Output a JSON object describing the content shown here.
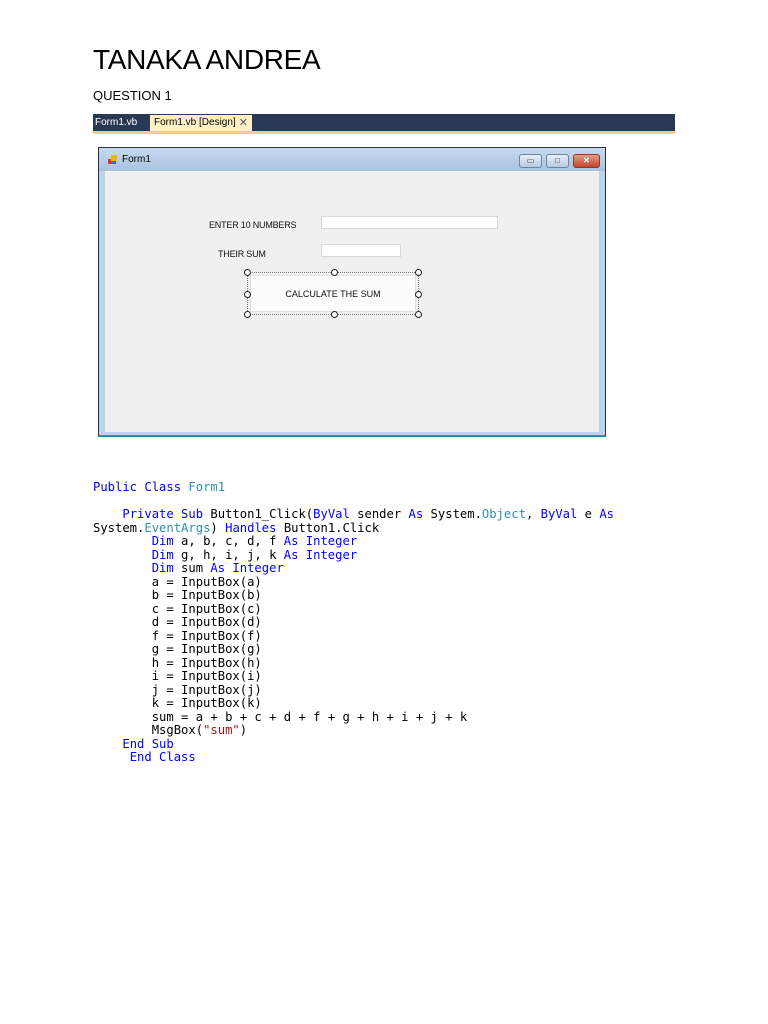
{
  "document": {
    "author": "TANAKA ANDREA",
    "question": "QUESTION 1"
  },
  "ide": {
    "tabs": [
      {
        "label": "Form1.vb",
        "active": false
      },
      {
        "label": "Form1.vb [Design]",
        "active": true
      }
    ],
    "tab_close": "✕"
  },
  "form": {
    "title": "Form1",
    "controls": {
      "label1": "ENTER 10 NUMBERS",
      "label2": "THEIR SUM",
      "button": "CALCULATE THE SUM",
      "textbox1_value": "",
      "textbox2_value": ""
    },
    "window_buttons": {
      "minimize": "▭",
      "maximize": "□",
      "close": "✕"
    }
  },
  "colors": {
    "keyword": "#0000ff",
    "type": "#2b91af",
    "string": "#a31515"
  },
  "code": [
    [
      [
        "Public Class ",
        "kw"
      ],
      [
        "Form1",
        "ty"
      ]
    ],
    [],
    [
      [
        "    "
      ],
      [
        "Private Sub",
        "kw"
      ],
      [
        " Button1_Click("
      ],
      [
        "ByVal",
        "kw"
      ],
      [
        " sender "
      ],
      [
        "As",
        "kw"
      ],
      [
        " System."
      ],
      [
        "Object",
        "ty"
      ],
      [
        ", "
      ],
      [
        "ByVal",
        "kw"
      ],
      [
        " e "
      ],
      [
        "As",
        "kw"
      ]
    ],
    [
      [
        "System."
      ],
      [
        "EventArgs",
        "ty"
      ],
      [
        ") "
      ],
      [
        "Handles",
        "kw"
      ],
      [
        " Button1.Click"
      ]
    ],
    [
      [
        "        "
      ],
      [
        "Dim",
        "kw"
      ],
      [
        " a, b, c, d, f "
      ],
      [
        "As Integer",
        "kw"
      ]
    ],
    [
      [
        "        "
      ],
      [
        "Dim",
        "kw"
      ],
      [
        " g, h, i, j, k "
      ],
      [
        "As Integer",
        "kw"
      ]
    ],
    [
      [
        "        "
      ],
      [
        "Dim",
        "kw"
      ],
      [
        " sum "
      ],
      [
        "As Integer",
        "kw"
      ]
    ],
    [
      [
        "        a = InputBox(a)"
      ]
    ],
    [
      [
        "        b = InputBox(b)"
      ]
    ],
    [
      [
        "        c = InputBox(c)"
      ]
    ],
    [
      [
        "        d = InputBox(d)"
      ]
    ],
    [
      [
        "        f = InputBox(f)"
      ]
    ],
    [
      [
        "        g = InputBox(g)"
      ]
    ],
    [
      [
        "        h = InputBox(h)"
      ]
    ],
    [
      [
        "        i = InputBox(i)"
      ]
    ],
    [
      [
        "        j = InputBox(j)"
      ]
    ],
    [
      [
        "        k = InputBox(k)"
      ]
    ],
    [
      [
        "        sum = a + b + c + d + f + g + h + i + j + k"
      ]
    ],
    [
      [
        "        MsgBox("
      ],
      [
        "\"sum\"",
        "st"
      ],
      [
        ")"
      ]
    ],
    [
      [
        "    "
      ],
      [
        "End Sub",
        "kw"
      ]
    ],
    [
      [
        "     "
      ],
      [
        "End Class",
        "kw"
      ]
    ]
  ]
}
